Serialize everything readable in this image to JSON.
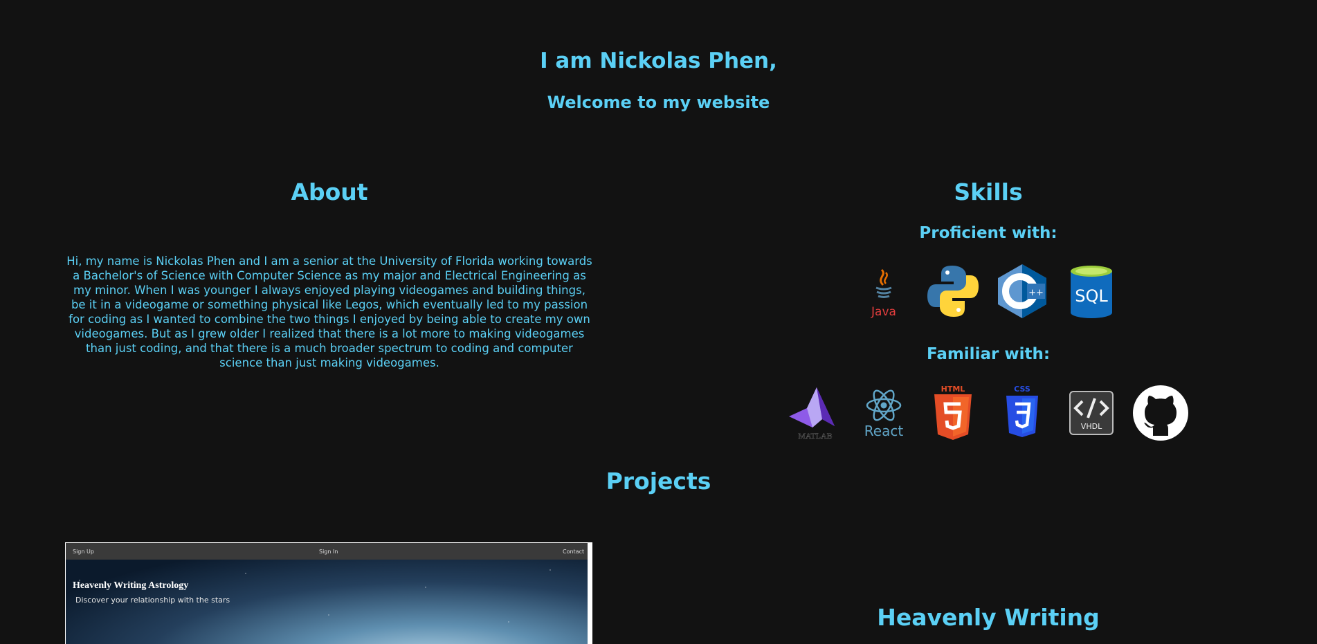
{
  "header": {
    "name_line": "I am Nickolas Phen,",
    "welcome": "Welcome to my website"
  },
  "about": {
    "title": "About",
    "text": "Hi, my name is Nickolas Phen and I am a senior at the University of Florida working towards a Bachelor's of Science with Computer Science as my major and Electrical Engineering as my minor. When I was younger I always enjoyed playing videogames and building things, be it in a videogame or something physical like Legos, which eventually led to my passion for coding as I wanted to combine the two things I enjoyed by being able to create my own videogames. But as I grew older I realized that there is a lot more to making videogames than just coding, and that there is a much broader spectrum to coding and computer science than just making videogames."
  },
  "skills": {
    "title": "Skills",
    "proficient_label": "Proficient with:",
    "familiar_label": "Familiar with:",
    "proficient": [
      {
        "icon": "java-icon",
        "label": "Java"
      },
      {
        "icon": "python-icon",
        "label": ""
      },
      {
        "icon": "cplusplus-icon",
        "label": "C++"
      },
      {
        "icon": "sql-icon",
        "label": "SQL"
      }
    ],
    "familiar": [
      {
        "icon": "matlab-icon",
        "label": "MATLAB"
      },
      {
        "icon": "react-icon",
        "label": "React"
      },
      {
        "icon": "html5-icon",
        "label": "HTML"
      },
      {
        "icon": "css3-icon",
        "label": "CSS"
      },
      {
        "icon": "vhdl-icon",
        "label": "VHDL"
      },
      {
        "icon": "github-icon",
        "label": ""
      }
    ]
  },
  "projects": {
    "title": "Projects",
    "items": [
      {
        "title": "Heavenly Writing",
        "screenshot": {
          "nav": [
            "Sign Up",
            "Sign In",
            "Contact"
          ],
          "site_title": "Heavenly Writing Astrology",
          "tagline": "Discover your relationship with the stars"
        }
      }
    ]
  },
  "colors": {
    "background": "#121212",
    "accent": "#5bd0f5"
  }
}
